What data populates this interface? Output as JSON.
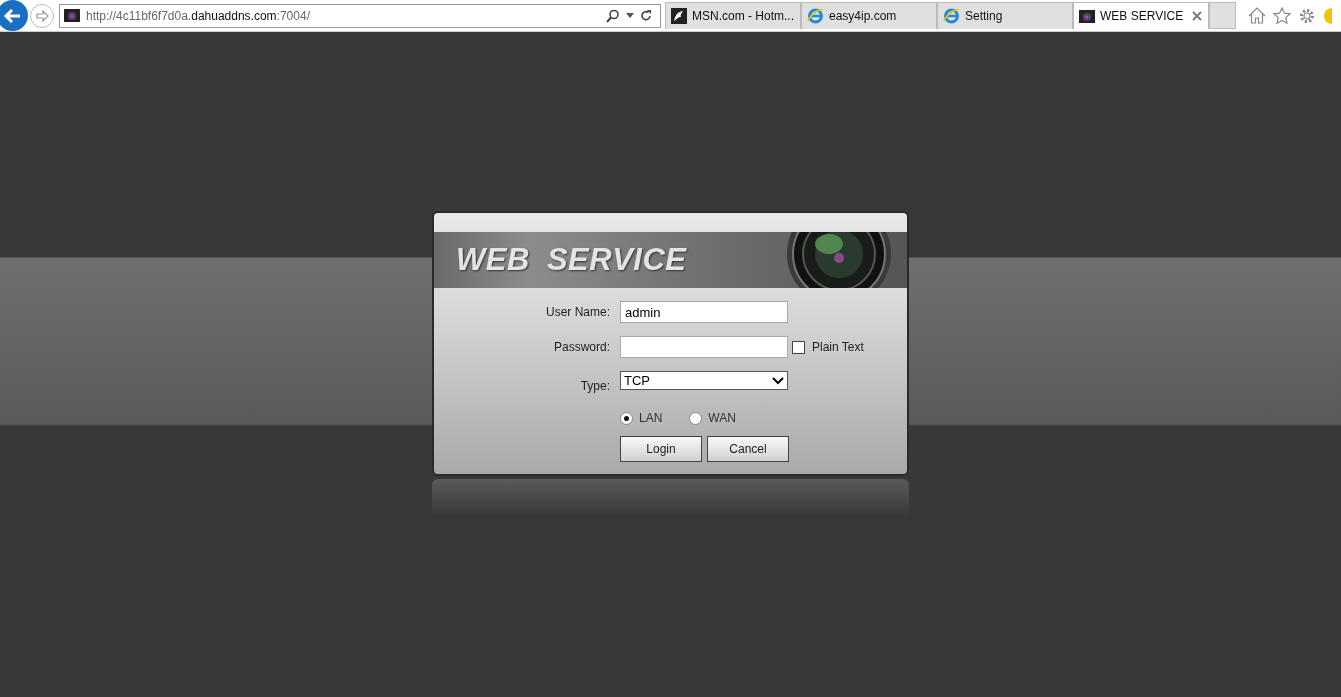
{
  "browser": {
    "address": "http://4c11bf6f7d0a.**dahuaddns.com**:7004/",
    "tabs": [
      {
        "label": "MSN.com - Hotm...",
        "kind": "msn",
        "selected": false
      },
      {
        "label": "easy4ip.com",
        "kind": "ie",
        "selected": false
      },
      {
        "label": "Setting",
        "kind": "ie",
        "selected": false
      },
      {
        "label": "WEB SERVICE",
        "kind": "camera",
        "selected": true
      }
    ]
  },
  "login": {
    "title": "WEB SERVICE",
    "username": {
      "label": "User Name:",
      "value": "admin"
    },
    "password": {
      "label": "Password:"
    },
    "plain_text": {
      "label": "Plain Text",
      "checked": false
    },
    "type": {
      "label": "Type:",
      "value": "TCP"
    },
    "network": [
      {
        "label": "LAN",
        "selected": true
      },
      {
        "label": "WAN",
        "selected": false
      }
    ],
    "buttons": [
      "Login",
      "Cancel"
    ]
  }
}
